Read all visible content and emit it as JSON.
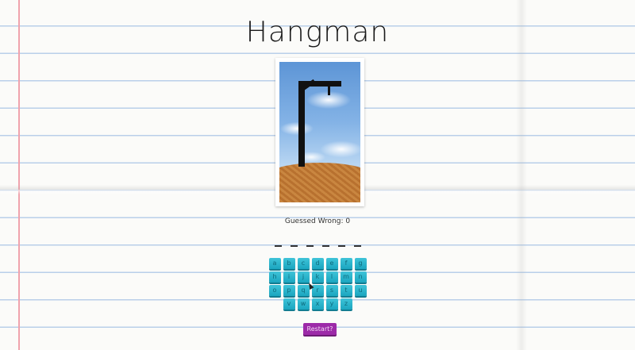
{
  "game": {
    "title": "Hangman",
    "guessed_wrong_label": "Guessed Wrong:",
    "guessed_wrong_count": "0",
    "word_slots": 6,
    "keyboard_rows": [
      [
        "a",
        "b",
        "c",
        "d",
        "e",
        "f",
        "g"
      ],
      [
        "h",
        "i",
        "j",
        "k",
        "l",
        "m",
        "n"
      ],
      [
        "o",
        "p",
        "q",
        "r",
        "s",
        "t",
        "u"
      ],
      [
        "v",
        "w",
        "x",
        "y",
        "z"
      ]
    ],
    "restart_label": "Restart?"
  },
  "colors": {
    "key": "#1ba6c0",
    "restart": "#9c2aa8",
    "sky": "#5d95d6",
    "ground": "#b8712f"
  }
}
